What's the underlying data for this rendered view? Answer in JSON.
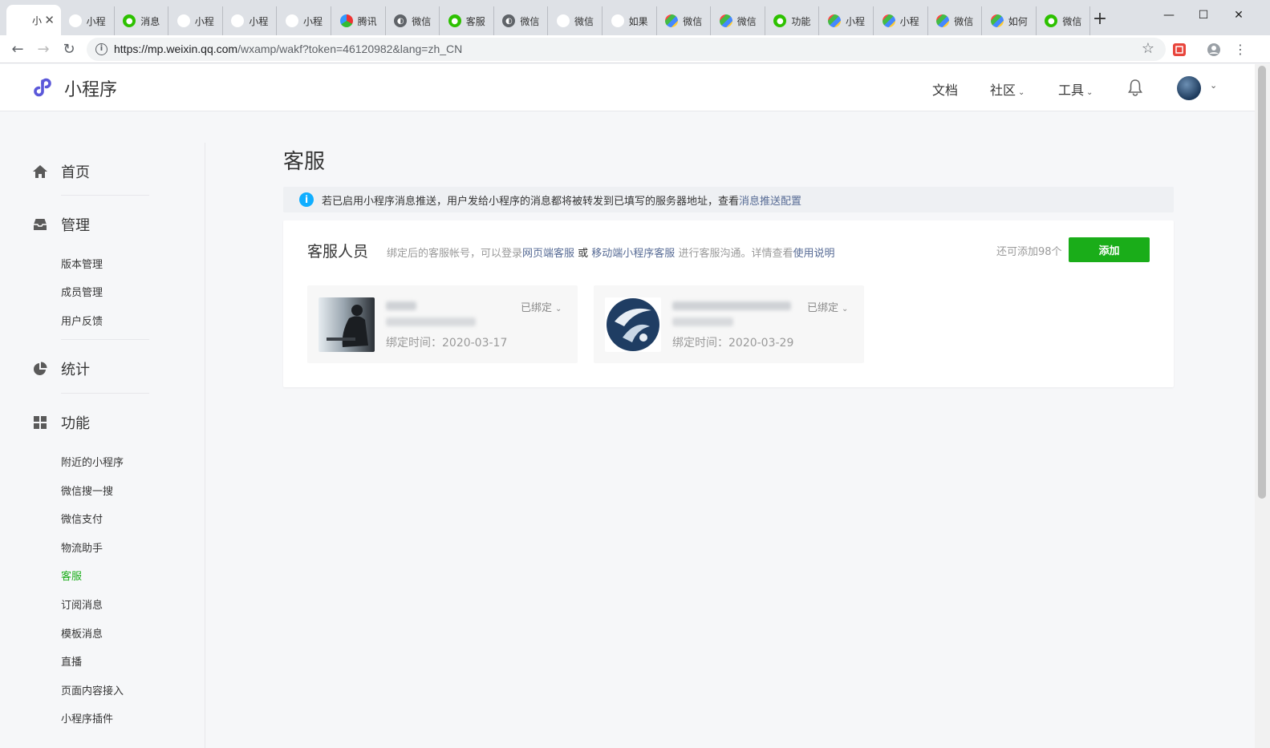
{
  "browser": {
    "tabs": [
      {
        "label": "小",
        "icon": "miniprogram-icon",
        "active": true
      },
      {
        "label": "小程",
        "icon": "miniprogram-icon"
      },
      {
        "label": "消息",
        "icon": "wechat-icon"
      },
      {
        "label": "小程",
        "icon": "miniprogram-icon"
      },
      {
        "label": "小程",
        "icon": "miniprogram-icon"
      },
      {
        "label": "小程",
        "icon": "miniprogram-icon"
      },
      {
        "label": "腾讯",
        "icon": "tencent-icon"
      },
      {
        "label": "微信",
        "icon": "globe-icon"
      },
      {
        "label": "客服",
        "icon": "wechat-icon"
      },
      {
        "label": "微信",
        "icon": "globe-icon"
      },
      {
        "label": "微信",
        "icon": "baidu-icon"
      },
      {
        "label": "如果",
        "icon": "baidu-icon"
      },
      {
        "label": "微信",
        "icon": "grid-icon"
      },
      {
        "label": "微信",
        "icon": "grid-icon"
      },
      {
        "label": "功能",
        "icon": "wechat-icon"
      },
      {
        "label": "小程",
        "icon": "grid-icon"
      },
      {
        "label": "小程",
        "icon": "grid-icon"
      },
      {
        "label": "微信",
        "icon": "grid-icon"
      },
      {
        "label": "如何",
        "icon": "grid-icon"
      },
      {
        "label": "微信",
        "icon": "wechat-icon"
      }
    ],
    "new_tab": "+",
    "url_host": "https://mp.weixin.qq.com",
    "url_path": "/wxamp/wakf?token=46120982&lang=zh_CN"
  },
  "header": {
    "brand": "小程序",
    "nav": {
      "docs": "文档",
      "community": "社区",
      "tools": "工具"
    }
  },
  "sidebar": {
    "groups": {
      "home": "首页",
      "manage": "管理",
      "stats": "统计",
      "features": "功能"
    },
    "manage_items": [
      "版本管理",
      "成员管理",
      "用户反馈"
    ],
    "feature_items": [
      "附近的小程序",
      "微信搜一搜",
      "微信支付",
      "物流助手",
      "客服",
      "订阅消息",
      "模板消息",
      "直播",
      "页面内容接入",
      "小程序插件"
    ],
    "active_item": "客服"
  },
  "main": {
    "title": "客服",
    "notice": {
      "text": "若已启用小程序消息推送，用户发给小程序的消息都将被转发到已填写的服务器地址，查看 ",
      "link": "消息推送配置"
    },
    "agents_card": {
      "title": "客服人员",
      "desc_1": "绑定后的客服帐号，可以登录",
      "link_web": "网页端客服",
      "or": " 或 ",
      "link_mobile": "移动端小程序客服",
      "desc_2": " 进行客服沟通。详情查看",
      "link_help": "使用说明",
      "remaining": "还可添加98个",
      "add_label": "添加",
      "agents": [
        {
          "status": "已绑定",
          "bind_time": "绑定时间：2020-03-17"
        },
        {
          "status": "已绑定",
          "bind_time": "绑定时间：2020-03-29"
        }
      ]
    }
  },
  "colors": {
    "accent": "#1aad19",
    "link": "#576b95",
    "info": "#10aeff",
    "brand_logo": "#5b58d9"
  }
}
